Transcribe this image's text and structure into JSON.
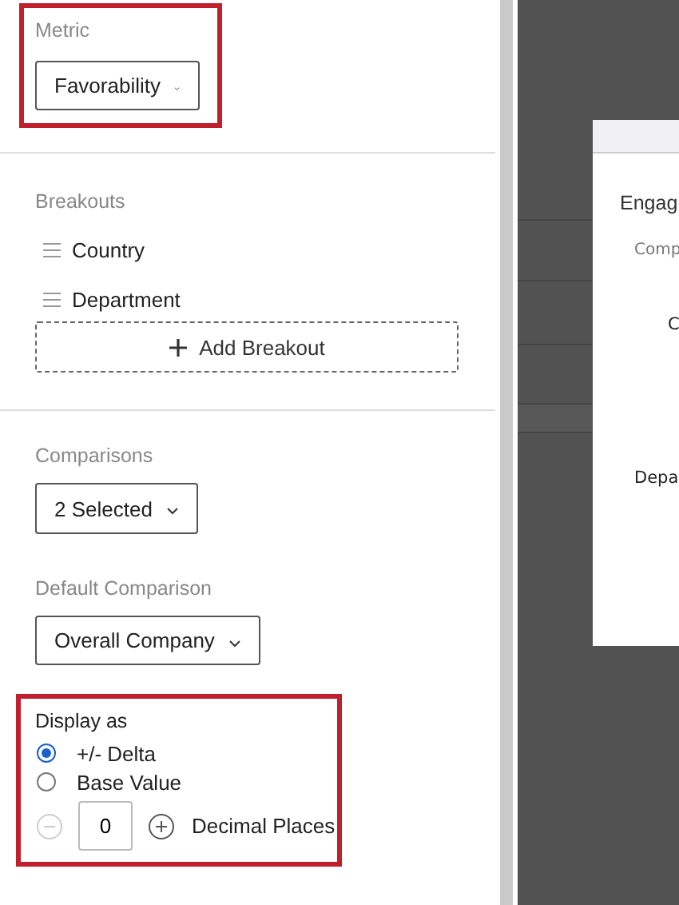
{
  "metric": {
    "label": "Metric",
    "value": "Favorability",
    "highlighted": true
  },
  "breakouts": {
    "label": "Breakouts",
    "items": [
      "Country",
      "Department"
    ],
    "add_button": "Add Breakout"
  },
  "comparisons": {
    "label": "Comparisons",
    "value": "2 Selected"
  },
  "default_comparison": {
    "label": "Default Comparison",
    "value": "Overall Company"
  },
  "display_as": {
    "label": "Display as",
    "highlighted": true,
    "options": [
      {
        "label": "+/- Delta",
        "selected": true
      },
      {
        "label": "Base Value",
        "selected": false
      }
    ],
    "decimal": {
      "value": "0",
      "label": "Decimal Places",
      "decrement_disabled": true
    }
  },
  "preview": {
    "title": "Engag",
    "subtitle": "Comp",
    "row_labels": [
      "C",
      "Depa"
    ]
  }
}
